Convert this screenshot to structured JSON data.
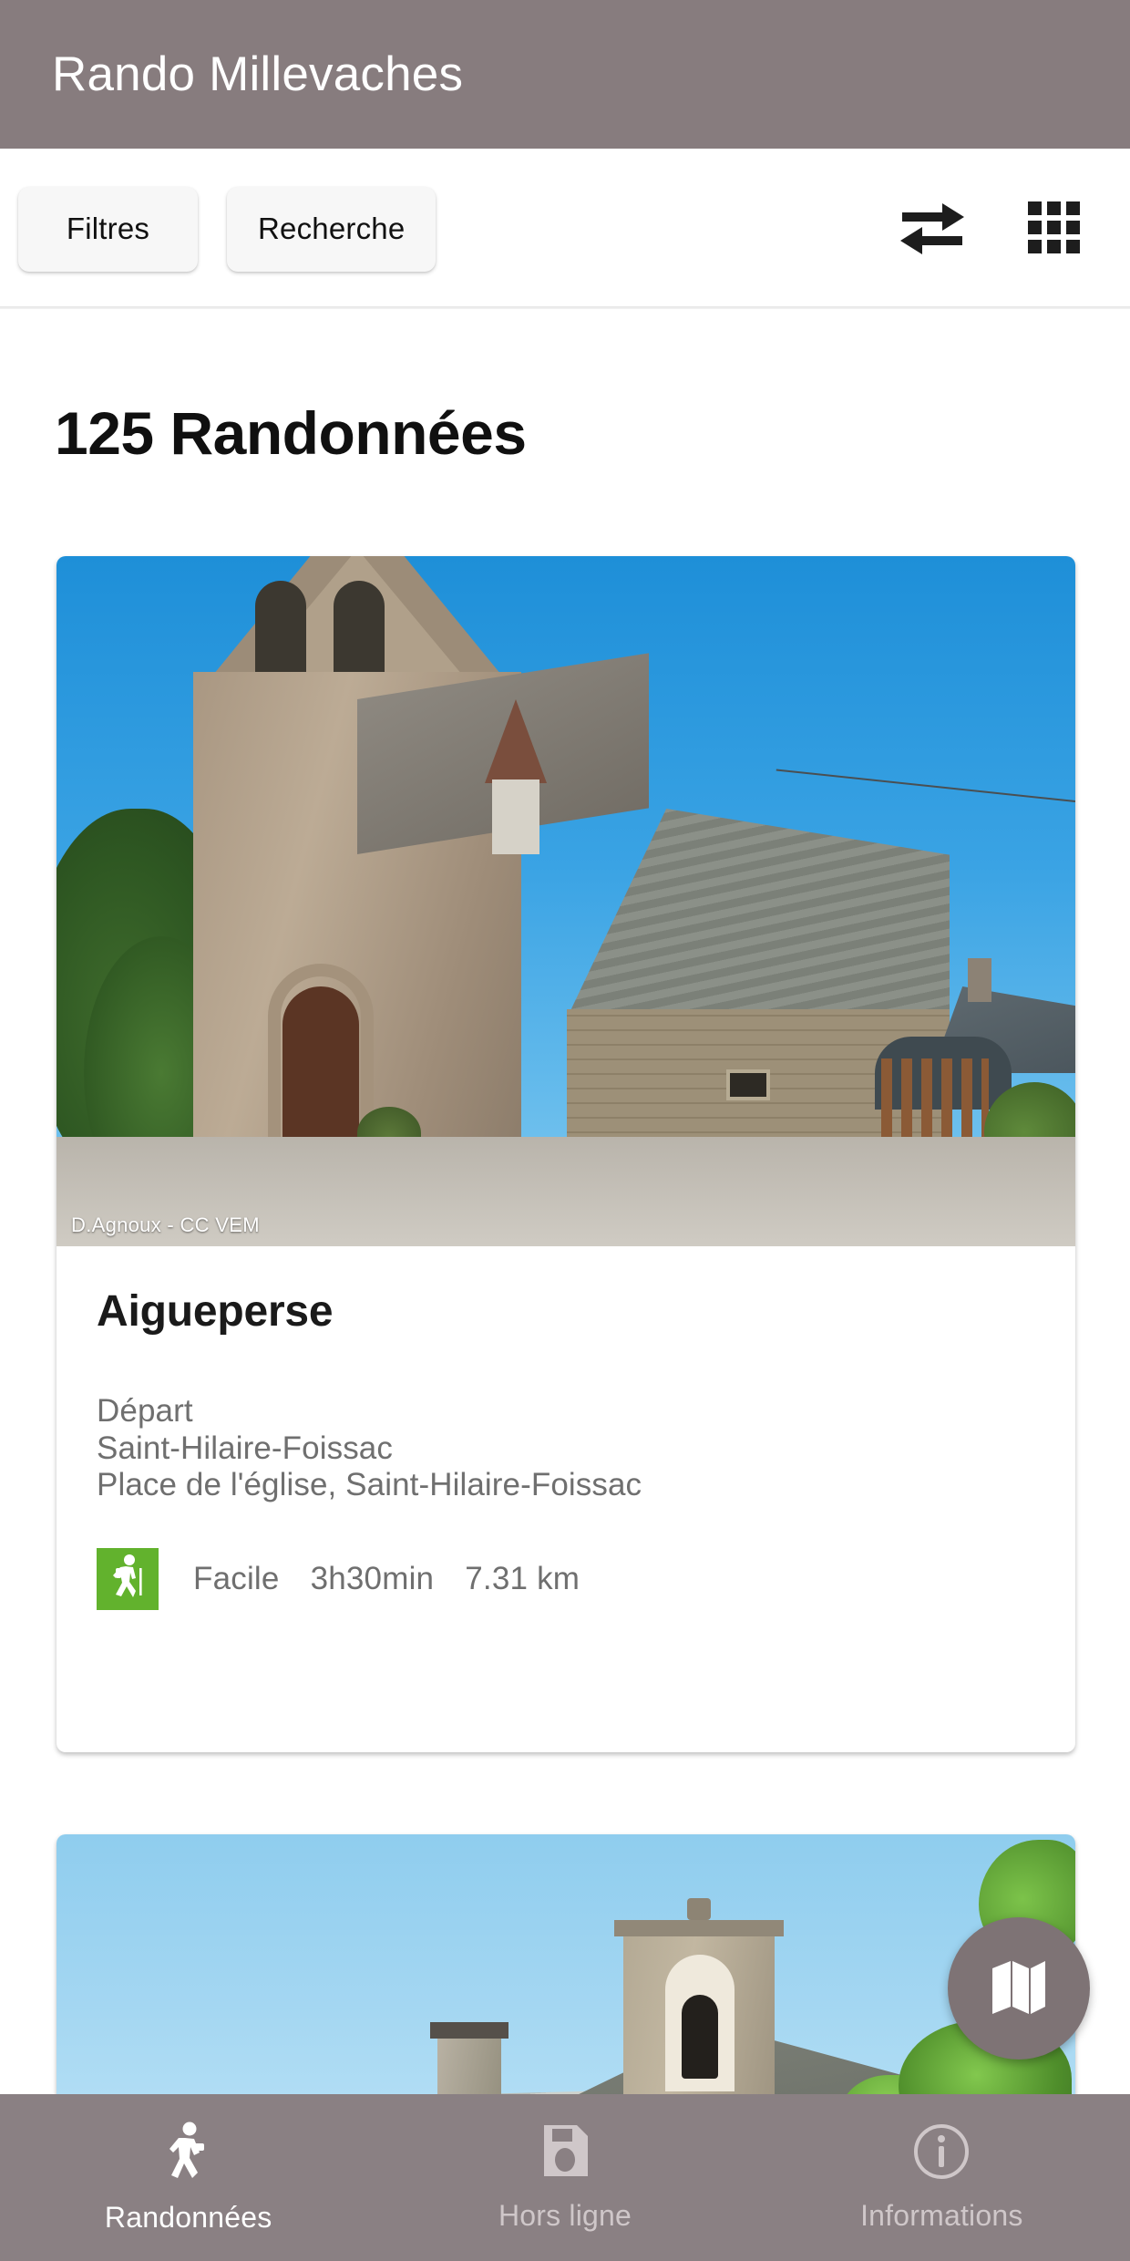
{
  "app": {
    "title": "Rando Millevaches",
    "header_color": "#877C7E",
    "accent_color": "#62B22D"
  },
  "toolbar": {
    "filters_label": "Filtres",
    "search_label": "Recherche",
    "sort_icon": "swap-arrows-icon",
    "grid_icon": "grid-view-icon"
  },
  "main": {
    "heading": "125 Randonnées",
    "count": 125,
    "cards": [
      {
        "title": "Aigueperse",
        "photo_credit": "D.Agnoux - CC VEM",
        "depart_label": "Départ",
        "commune": "Saint-Hilaire-Foissac",
        "address": "Place de l'église, Saint-Hilaire-Foissac",
        "difficulty": "Facile",
        "duration": "3h30min",
        "distance": "7.31 km",
        "difficulty_icon": "hiker-icon",
        "difficulty_color": "#62B22D"
      }
    ]
  },
  "fab": {
    "icon": "map-icon",
    "color": "#7e7375"
  },
  "bottomnav": {
    "items": [
      {
        "label": "Randonnées",
        "icon": "hiker-icon",
        "active": true
      },
      {
        "label": "Hors ligne",
        "icon": "save-disk-icon",
        "active": false
      },
      {
        "label": "Informations",
        "icon": "info-circle-icon",
        "active": false
      }
    ]
  }
}
